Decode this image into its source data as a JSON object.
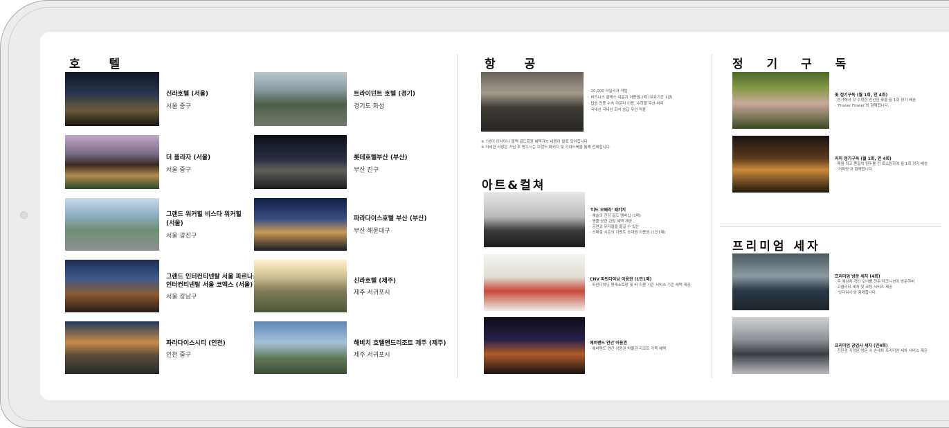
{
  "sections": {
    "hotel": "호 텔",
    "air": "항 공",
    "art": "아트&컬쳐",
    "subscription": "정 기 구 독",
    "premium": "프리미엄 세자"
  },
  "hotels": [
    {
      "name": "신라호텔 (서울)",
      "loc": "서울 중구"
    },
    {
      "name": "트라이던트 호텔 (경기)",
      "loc": "경기도 화성"
    },
    {
      "name": "더 플라자 (서울)",
      "loc": "서울 중구"
    },
    {
      "name": "롯데호텔부산 (부산)",
      "loc": "부산 진구"
    },
    {
      "name": "그랜드 워커힐 비스타 워커힐 (서울)",
      "name2": "",
      "loc": "서울 광진구"
    },
    {
      "name": "파라다이스호텔 부산 (부산)",
      "loc": "부산 해운대구"
    },
    {
      "name": "그랜드 인터컨티넨탈 서울 파르나스",
      "name2": "인터컨티넨탈 서울 코엑스 (서울)",
      "loc": "서울 강남구"
    },
    {
      "name": "신라호텔 (제주)",
      "loc": "제주 서귀포시"
    },
    {
      "name": "파라다이스시티 (인천)",
      "loc": "인천 중구"
    },
    {
      "name": "해비치 호텔앤드리조트 제주 (제주)",
      "loc": "제주 서귀포시"
    }
  ],
  "air": {
    "lines": [
      "· 20,000 마일리지 적립",
      "· 비즈니스 클래스 라운지 이용권 2매 (유효기간 1년)",
      "· 탑승 전용 수속 카운터 이용, 수하물 우선 처리",
      "· 국내선 국내선 좌석 승급 우선 적용"
    ],
    "notes": [
      "※ 7성이 이사이나 블랙 골드회원 혜택가능 내용이 발표 되어집니다",
      "※ 자세한 사항은 가입 후 받으시는 브랜드 패키지 및 가이드북을 통해 안내됩니다"
    ]
  },
  "art": [
    {
      "title": "'미드 오페라' 패키지",
      "lines": [
        "· 예술의 전당 골드 멤버십 (1매)",
        "· 명품 공연 관람 혜택 제공",
        "· 공연과 뮤지컬을 즐길 수 있는",
        "· 스페셜 시즌의 이벤트 초대권 이용권 (1인1매)"
      ]
    },
    {
      "title": "CNV 파인다이닝 이용권 (1인1매)",
      "lines": [
        "· 파인다이닝 명레스토랑 및 바 이용 시즌 서비스 기준 혜택 제공"
      ]
    },
    {
      "title": "에버랜드 연간 이용권",
      "lines": [
        "· 에버랜드 연간 이용권 박물관 리조트 가족 혜택"
      ]
    }
  ],
  "subscription": [
    {
      "title": "꽃 정기구독 (월 1회, 연 4회)",
      "lines": [
        "· 농가에서 갓 수확한 신선한 꽃을 월 1회 정기 배송",
        "· 'Flower Flower'와 함께합니다."
      ]
    },
    {
      "title": "커피 정기구독 (월 1회, 연 4회)",
      "lines": [
        "· 매월 최고 품질의 원두를 전 로스팅하여 월 1회 정기 배송",
        "· '커피랑'과 함께합니다."
      ]
    }
  ],
  "premium": [
    {
      "title": "프리미엄 방문 세차 (4회)",
      "lines": [
        "· 주 예상치 개인 오너를 전문 테크니션이 방문하여",
        "· 고퀄리티 세차 및 코팅 서비스 제공",
        "· '잇더워시'와 함께합니다."
      ]
    },
    {
      "title": "프리미엄 공업사 세차 (연4회)",
      "lines": [
        "· 친환경 지정된 방문 시 손세차 프리미엄 세차 서비스 제공"
      ]
    }
  ]
}
